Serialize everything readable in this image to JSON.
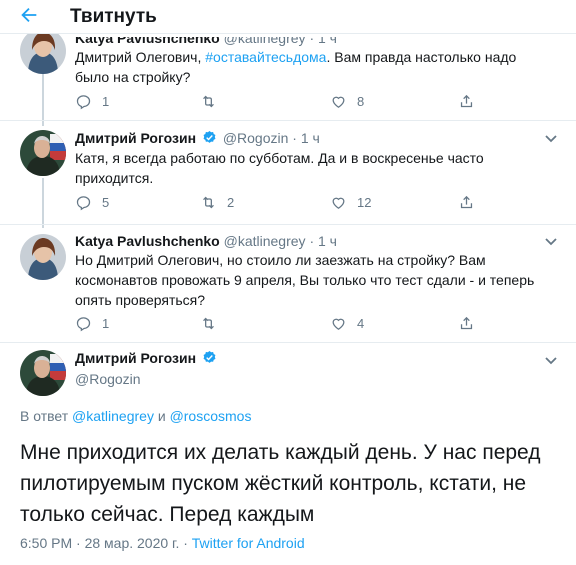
{
  "header": {
    "title": "Твитнуть"
  },
  "tweets": [
    {
      "name": "Katya Pavlushchenko",
      "handle": "@katlinegrey",
      "time": "· 1 ч",
      "text_before": "Дмитрий Олегович, ",
      "hashtag": "#оставайтесьдома",
      "text_after": ". Вам правда настолько надо было на стройку?",
      "replies": "1",
      "retweets": "",
      "likes": "8"
    },
    {
      "name": "Дмитрий Рогозин",
      "handle": "@Rogozin",
      "time": "· 1 ч",
      "text": "Катя, я всегда работаю по субботам. Да и в воскресенье часто приходится.",
      "replies": "5",
      "retweets": "2",
      "likes": "12"
    },
    {
      "name": "Katya Pavlushchenko",
      "handle": "@katlinegrey",
      "time": "· 1 ч",
      "text": "Но Дмитрий Олегович, но стоило ли заезжать на стройку? Вам космонавтов провожать 9 апреля, Вы только что тест сдали - и теперь опять проверяться?",
      "replies": "1",
      "retweets": "",
      "likes": "4"
    }
  ],
  "main_tweet": {
    "name": "Дмитрий Рогозин",
    "handle": "@Rogozin",
    "reply_prefix": "В ответ ",
    "reply_user1": "@katlinegrey",
    "reply_and": " и ",
    "reply_user2": "@roscosmos",
    "text": "Мне приходится их делать каждый день. У нас перед пилотируемым пуском жёсткий контроль, кстати, не только сейчас. Перед каждым",
    "timestamp": "6:50 PM · 28 мар. 2020 г. · ",
    "source": "Twitter for Android"
  },
  "colors": {
    "accent": "#1da1f2",
    "muted": "#657786",
    "text": "#14171a",
    "divider": "#e6ecf0"
  },
  "icons": {
    "back": "arrow-left-icon",
    "reply": "reply-icon",
    "retweet": "retweet-icon",
    "like": "heart-icon",
    "share": "share-icon",
    "verified": "verified-badge-icon",
    "more": "chevron-down-icon"
  }
}
